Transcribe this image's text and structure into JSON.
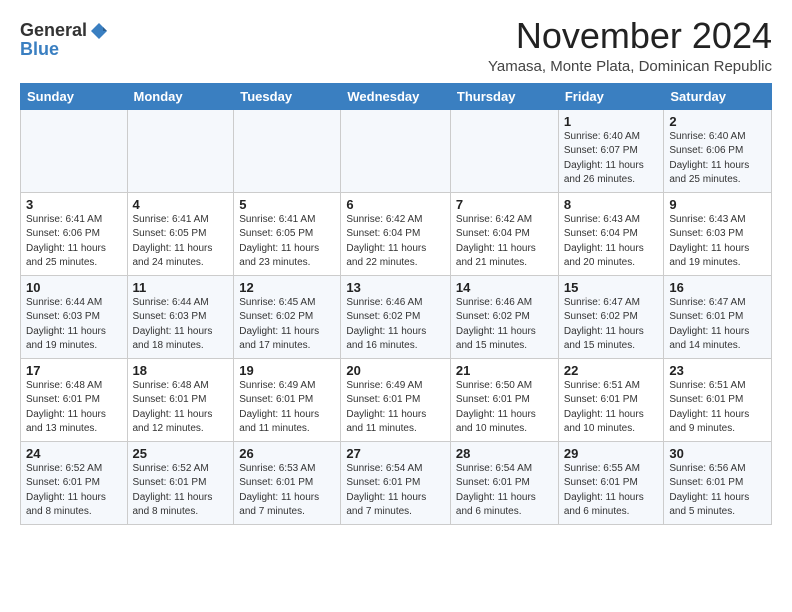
{
  "logo": {
    "general": "General",
    "blue": "Blue"
  },
  "title": "November 2024",
  "location": "Yamasa, Monte Plata, Dominican Republic",
  "weekdays": [
    "Sunday",
    "Monday",
    "Tuesday",
    "Wednesday",
    "Thursday",
    "Friday",
    "Saturday"
  ],
  "weeks": [
    [
      {
        "day": "",
        "info": ""
      },
      {
        "day": "",
        "info": ""
      },
      {
        "day": "",
        "info": ""
      },
      {
        "day": "",
        "info": ""
      },
      {
        "day": "",
        "info": ""
      },
      {
        "day": "1",
        "info": "Sunrise: 6:40 AM\nSunset: 6:07 PM\nDaylight: 11 hours\nand 26 minutes."
      },
      {
        "day": "2",
        "info": "Sunrise: 6:40 AM\nSunset: 6:06 PM\nDaylight: 11 hours\nand 25 minutes."
      }
    ],
    [
      {
        "day": "3",
        "info": "Sunrise: 6:41 AM\nSunset: 6:06 PM\nDaylight: 11 hours\nand 25 minutes."
      },
      {
        "day": "4",
        "info": "Sunrise: 6:41 AM\nSunset: 6:05 PM\nDaylight: 11 hours\nand 24 minutes."
      },
      {
        "day": "5",
        "info": "Sunrise: 6:41 AM\nSunset: 6:05 PM\nDaylight: 11 hours\nand 23 minutes."
      },
      {
        "day": "6",
        "info": "Sunrise: 6:42 AM\nSunset: 6:04 PM\nDaylight: 11 hours\nand 22 minutes."
      },
      {
        "day": "7",
        "info": "Sunrise: 6:42 AM\nSunset: 6:04 PM\nDaylight: 11 hours\nand 21 minutes."
      },
      {
        "day": "8",
        "info": "Sunrise: 6:43 AM\nSunset: 6:04 PM\nDaylight: 11 hours\nand 20 minutes."
      },
      {
        "day": "9",
        "info": "Sunrise: 6:43 AM\nSunset: 6:03 PM\nDaylight: 11 hours\nand 19 minutes."
      }
    ],
    [
      {
        "day": "10",
        "info": "Sunrise: 6:44 AM\nSunset: 6:03 PM\nDaylight: 11 hours\nand 19 minutes."
      },
      {
        "day": "11",
        "info": "Sunrise: 6:44 AM\nSunset: 6:03 PM\nDaylight: 11 hours\nand 18 minutes."
      },
      {
        "day": "12",
        "info": "Sunrise: 6:45 AM\nSunset: 6:02 PM\nDaylight: 11 hours\nand 17 minutes."
      },
      {
        "day": "13",
        "info": "Sunrise: 6:46 AM\nSunset: 6:02 PM\nDaylight: 11 hours\nand 16 minutes."
      },
      {
        "day": "14",
        "info": "Sunrise: 6:46 AM\nSunset: 6:02 PM\nDaylight: 11 hours\nand 15 minutes."
      },
      {
        "day": "15",
        "info": "Sunrise: 6:47 AM\nSunset: 6:02 PM\nDaylight: 11 hours\nand 15 minutes."
      },
      {
        "day": "16",
        "info": "Sunrise: 6:47 AM\nSunset: 6:01 PM\nDaylight: 11 hours\nand 14 minutes."
      }
    ],
    [
      {
        "day": "17",
        "info": "Sunrise: 6:48 AM\nSunset: 6:01 PM\nDaylight: 11 hours\nand 13 minutes."
      },
      {
        "day": "18",
        "info": "Sunrise: 6:48 AM\nSunset: 6:01 PM\nDaylight: 11 hours\nand 12 minutes."
      },
      {
        "day": "19",
        "info": "Sunrise: 6:49 AM\nSunset: 6:01 PM\nDaylight: 11 hours\nand 11 minutes."
      },
      {
        "day": "20",
        "info": "Sunrise: 6:49 AM\nSunset: 6:01 PM\nDaylight: 11 hours\nand 11 minutes."
      },
      {
        "day": "21",
        "info": "Sunrise: 6:50 AM\nSunset: 6:01 PM\nDaylight: 11 hours\nand 10 minutes."
      },
      {
        "day": "22",
        "info": "Sunrise: 6:51 AM\nSunset: 6:01 PM\nDaylight: 11 hours\nand 10 minutes."
      },
      {
        "day": "23",
        "info": "Sunrise: 6:51 AM\nSunset: 6:01 PM\nDaylight: 11 hours\nand 9 minutes."
      }
    ],
    [
      {
        "day": "24",
        "info": "Sunrise: 6:52 AM\nSunset: 6:01 PM\nDaylight: 11 hours\nand 8 minutes."
      },
      {
        "day": "25",
        "info": "Sunrise: 6:52 AM\nSunset: 6:01 PM\nDaylight: 11 hours\nand 8 minutes."
      },
      {
        "day": "26",
        "info": "Sunrise: 6:53 AM\nSunset: 6:01 PM\nDaylight: 11 hours\nand 7 minutes."
      },
      {
        "day": "27",
        "info": "Sunrise: 6:54 AM\nSunset: 6:01 PM\nDaylight: 11 hours\nand 7 minutes."
      },
      {
        "day": "28",
        "info": "Sunrise: 6:54 AM\nSunset: 6:01 PM\nDaylight: 11 hours\nand 6 minutes."
      },
      {
        "day": "29",
        "info": "Sunrise: 6:55 AM\nSunset: 6:01 PM\nDaylight: 11 hours\nand 6 minutes."
      },
      {
        "day": "30",
        "info": "Sunrise: 6:56 AM\nSunset: 6:01 PM\nDaylight: 11 hours\nand 5 minutes."
      }
    ]
  ]
}
